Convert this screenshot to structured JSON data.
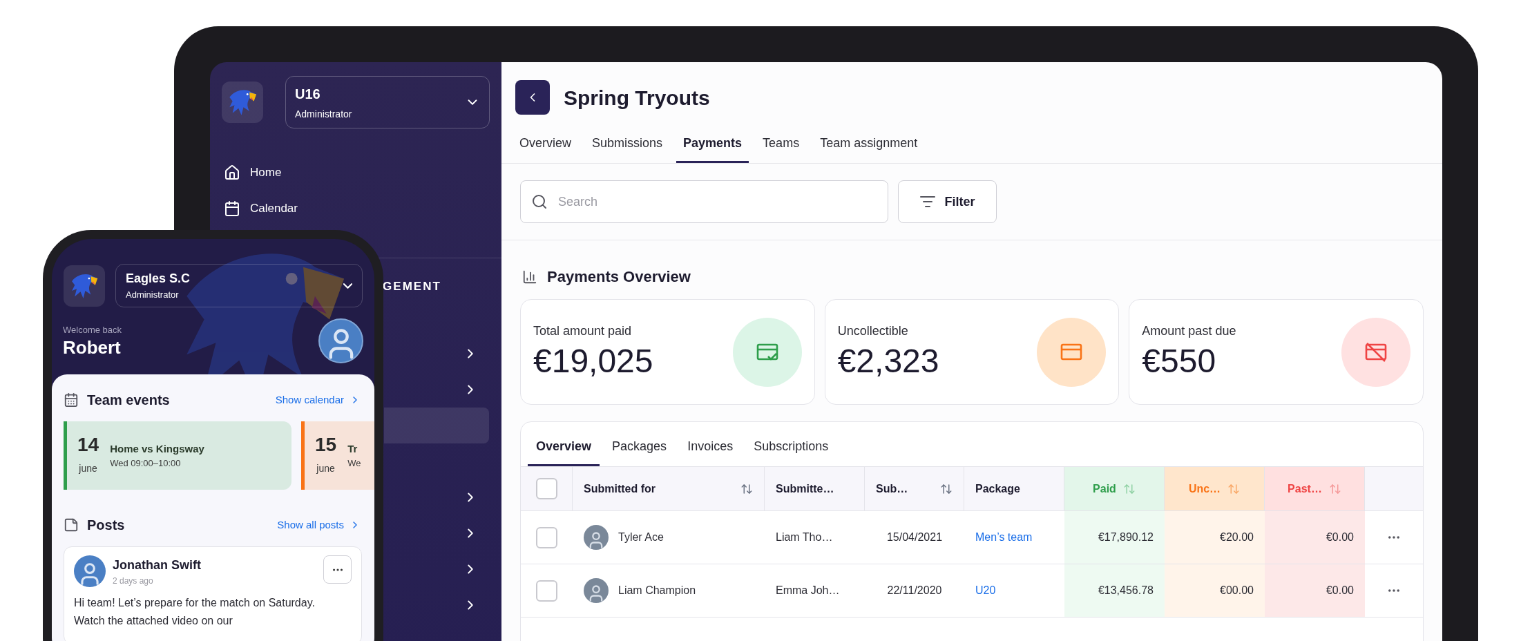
{
  "tablet": {
    "sidebar": {
      "team": {
        "name": "U16",
        "role": "Administrator"
      },
      "nav": [
        {
          "label": "Home"
        },
        {
          "label": "Calendar"
        }
      ],
      "section_heading": "GEMENT",
      "items": [
        {
          "kind": "group",
          "selected": false
        },
        {
          "kind": "group",
          "selected": false
        },
        {
          "kind": "link",
          "selected": true
        },
        {
          "kind": "group",
          "selected": false
        },
        {
          "kind": "group",
          "selected": false
        },
        {
          "kind": "group",
          "selected": false
        },
        {
          "kind": "group",
          "selected": false
        }
      ]
    },
    "page": {
      "title": "Spring Tryouts",
      "tabs": [
        {
          "label": "Overview",
          "selected": false
        },
        {
          "label": "Submissions",
          "selected": false
        },
        {
          "label": "Payments",
          "selected": true
        },
        {
          "label": "Teams",
          "selected": false
        },
        {
          "label": "Team assignment",
          "selected": false
        }
      ],
      "search": {
        "placeholder": "Search"
      },
      "filter_button": "Filter",
      "overview": {
        "title": "Payments Overview",
        "cards": [
          {
            "kind": "paid",
            "label": "Total amount paid",
            "value": "€19,025"
          },
          {
            "kind": "uncollectible",
            "label": "Uncollectible",
            "value": "€2,323"
          },
          {
            "kind": "past_due",
            "label": "Amount past due",
            "value": "€550"
          }
        ]
      },
      "payments": {
        "tabs": [
          {
            "label": "Overview",
            "selected": true
          },
          {
            "label": "Packages",
            "selected": false
          },
          {
            "label": "Invoices",
            "selected": false
          },
          {
            "label": "Subscriptions",
            "selected": false
          }
        ],
        "select_all_checked": false,
        "columns": [
          {
            "label": "Submitted for",
            "sortable": true,
            "kind": "person"
          },
          {
            "label": "Submitte…",
            "sortable": false,
            "kind": "text"
          },
          {
            "label": "Sub…",
            "sortable": true,
            "kind": "date"
          },
          {
            "label": "Package",
            "sortable": false,
            "kind": "link"
          },
          {
            "label": "Paid",
            "sortable": true,
            "kind": "paid"
          },
          {
            "label": "Unc…",
            "sortable": true,
            "kind": "uncollectible"
          },
          {
            "label": "Past…",
            "sortable": true,
            "kind": "past_due"
          }
        ],
        "rows": [
          {
            "checked": false,
            "cells": [
              "Tyler Ace",
              "Liam Tho…",
              "15/04/2021",
              "Men’s team",
              "€17,890.12",
              "€20.00",
              "€0.00"
            ]
          },
          {
            "checked": false,
            "cells": [
              "Liam Champion",
              "Emma Joh…",
              "22/11/2020",
              "U20",
              "€13,456.78",
              "€00.00",
              "€0.00"
            ]
          }
        ]
      }
    }
  },
  "phone": {
    "club": {
      "name": "Eagles S.C",
      "role": "Administrator"
    },
    "greeting": "Welcome back",
    "user": "Robert",
    "events_section": {
      "title": "Team events",
      "link": "Show calendar",
      "events": [
        {
          "day": "14",
          "month": "june",
          "title": "Home vs Kingsway",
          "time": "Wed 09:00–10:00",
          "color": "#2e9e4b"
        },
        {
          "day": "15",
          "month": "june",
          "title": "Tr",
          "time": "We",
          "color": "#f97316"
        }
      ]
    },
    "posts_section": {
      "title": "Posts",
      "link": "Show all posts",
      "posts": [
        {
          "author": "Jonathan Swift",
          "time": "2 days ago",
          "text": "Hi team! Let’s prepare for the match on Saturday. Watch the attached video on our"
        }
      ]
    }
  }
}
